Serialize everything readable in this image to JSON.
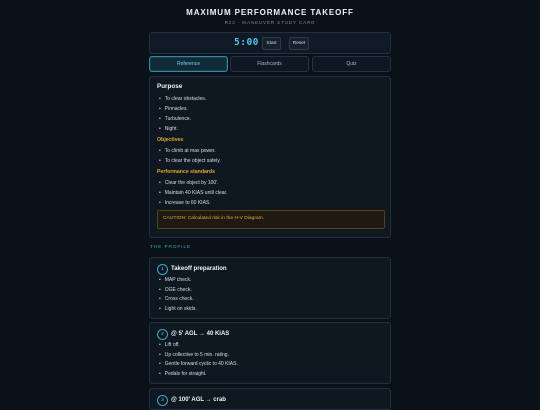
{
  "header": {
    "title": "MAXIMUM PERFORMANCE TAKEOFF",
    "subtitle": "R22 · MANEUVER STUDY CARD"
  },
  "timer": {
    "display": "5:00",
    "start_label": "Start",
    "reset_label": "Reset"
  },
  "tabs": [
    {
      "label": "Reference",
      "active": true
    },
    {
      "label": "Flashcards",
      "active": false
    },
    {
      "label": "Quiz",
      "active": false
    }
  ],
  "reference": {
    "purpose_heading": "Purpose",
    "purpose_items": [
      "To clear obstacles.",
      "Pinnacles.",
      "Turbulence.",
      "Night."
    ],
    "objectives_heading": "Objectives",
    "objectives_items": [
      "To climb at max power.",
      "To clear the object safely."
    ],
    "standards_heading": "Performance standards",
    "standards_items": [
      "Clear the object by 100'.",
      "Maintain 40 KIAS until clear.",
      "Increase to 60 KIAS."
    ],
    "caution": "CAUTION: Calculated risk in the H-V Diagram."
  },
  "profile": {
    "label": "THE PROFILE",
    "steps": [
      {
        "number": "1",
        "title": "Takeoff preparation",
        "items": [
          "MAP check.",
          "OGE check.",
          "Cross check.",
          "Light on skids."
        ]
      },
      {
        "number": "2",
        "title": "@ 5' AGL → 40 KIAS",
        "items": [
          "Lift off.",
          "Up collective to 5 min. rating.",
          "Gentle forward cyclic to 40 KIAS.",
          "Pedals for straight."
        ]
      },
      {
        "number": "3",
        "title": "@ 100' AGL → crab",
        "items": []
      }
    ]
  },
  "colors": {
    "background": "#0b1118",
    "accent": "#52c6ea",
    "section_heading": "#e5a72c",
    "caution_text": "#e9a93a"
  }
}
